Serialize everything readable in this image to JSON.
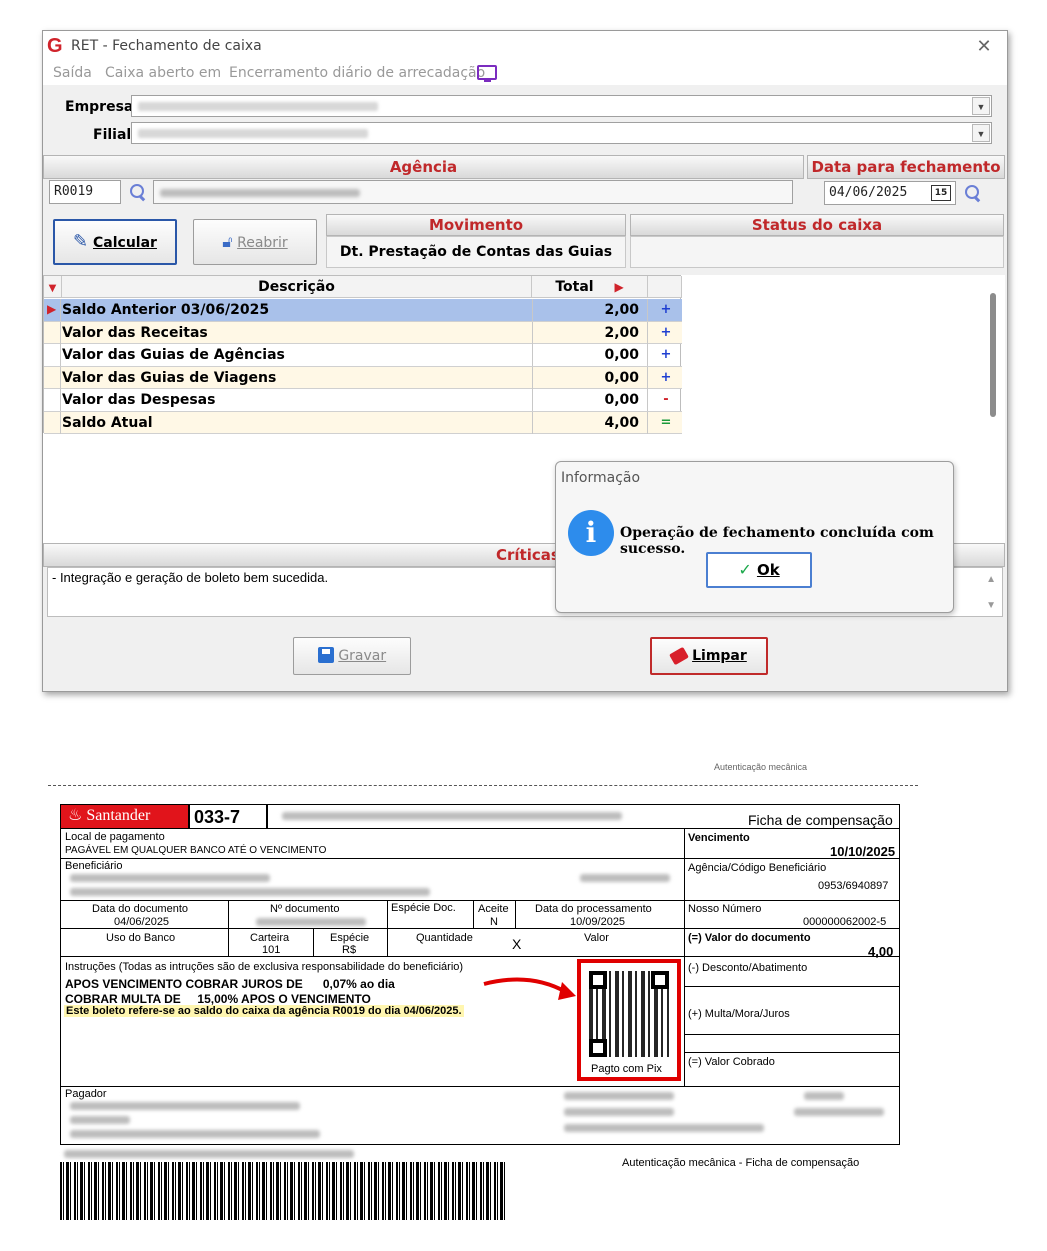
{
  "window": {
    "title": "RET - Fechamento de caixa",
    "close_glyph": "✕",
    "menu": [
      "Saída",
      "Caixa aberto em",
      "Encerramento diário de arrecadação"
    ]
  },
  "form": {
    "empresa_label": "Empresa",
    "filial_label": "Filial",
    "agencia_header": "Agência",
    "data_fechamento_header": "Data para fechamento",
    "agencia_code": "R0019",
    "data_fechamento": "04/06/2025",
    "calendar_day": "15",
    "calcular_label": "Calcular",
    "reabrir_label": "Reabrir",
    "movimento_header": "Movimento",
    "movimento_value": "Dt. Prestação de Contas das Guias",
    "status_header": "Status do caixa"
  },
  "grid": {
    "headers": [
      "Descrição",
      "Total"
    ],
    "rows": [
      {
        "desc": "Saldo Anterior  03/06/2025",
        "total": "2,00",
        "sign": "+"
      },
      {
        "desc": "Valor das Receitas",
        "total": "2,00",
        "sign": "+"
      },
      {
        "desc": "Valor das Guias de Agências",
        "total": "0,00",
        "sign": "+"
      },
      {
        "desc": "Valor das Guias de Viagens",
        "total": "0,00",
        "sign": "+"
      },
      {
        "desc": "Valor das Despesas",
        "total": "0,00",
        "sign": "-"
      },
      {
        "desc": "Saldo Atual",
        "total": "4,00",
        "sign": "="
      }
    ]
  },
  "criticas": {
    "header": "Críticas",
    "text": "- Integração e geração de boleto bem sucedida."
  },
  "footer": {
    "gravar_label": "Gravar",
    "limpar_label": "Limpar"
  },
  "dialog": {
    "title": "Informação",
    "icon": "i",
    "message": "Operação de fechamento concluída com sucesso.",
    "ok_label": "Ok"
  },
  "boleto": {
    "auth_top": "Autenticação mecânica",
    "bank_name": "Santander",
    "bank_code": "033-7",
    "ficha": "Ficha de compensação",
    "local_pagamento_label": "Local de pagamento",
    "local_pagamento_value": "PAGÁVEL EM QUALQUER BANCO ATÉ O VENCIMENTO",
    "vencimento_label": "Vencimento",
    "vencimento_value": "10/10/2025",
    "beneficiario_label": "Beneficiário",
    "agencia_cod_label": "Agência/Código Beneficiário",
    "agencia_cod_value": "0953/6940897",
    "data_doc_label": "Data do documento",
    "data_doc_value": "04/06/2025",
    "num_doc_label": "Nº documento",
    "especie_doc_label": "Espécie Doc.",
    "aceite_label": "Aceite",
    "aceite_value": "N",
    "data_proc_label": "Data do processamento",
    "data_proc_value": "10/09/2025",
    "nosso_numero_label": "Nosso Número",
    "nosso_numero_value": "000000062002-5",
    "uso_banco_label": "Uso do Banco",
    "carteira_label": "Carteira",
    "carteira_value": "101",
    "especie_label": "Espécie",
    "especie_value": "R$",
    "quantidade_label": "Quantidade",
    "x_mark": "X",
    "valor_label": "Valor",
    "valor_doc_label": "(=) Valor do documento",
    "valor_doc_value": "4,00",
    "instrucoes_label": "Instruções (Todas as intruções são de exclusiva responsabilidade do beneficiário)",
    "instr1": "APOS VENCIMENTO COBRAR JUROS DE      0,07% ao dia",
    "instr2": "COBRAR MULTA DE     15,00% APOS O VENCIMENTO",
    "instr3": "Este boleto refere-se ao saldo do caixa da agência R0019 do dia 04/06/2025.",
    "desconto_label": "(-) Desconto/Abatimento",
    "multa_label": "(+) Multa/Mora/Juros",
    "valor_cobrado_label": "(=) Valor Cobrado",
    "pix_label": "Pagto com Pix",
    "pagador_label": "Pagador",
    "auth_bottom": "Autenticação mecânica - Ficha de compensação"
  }
}
